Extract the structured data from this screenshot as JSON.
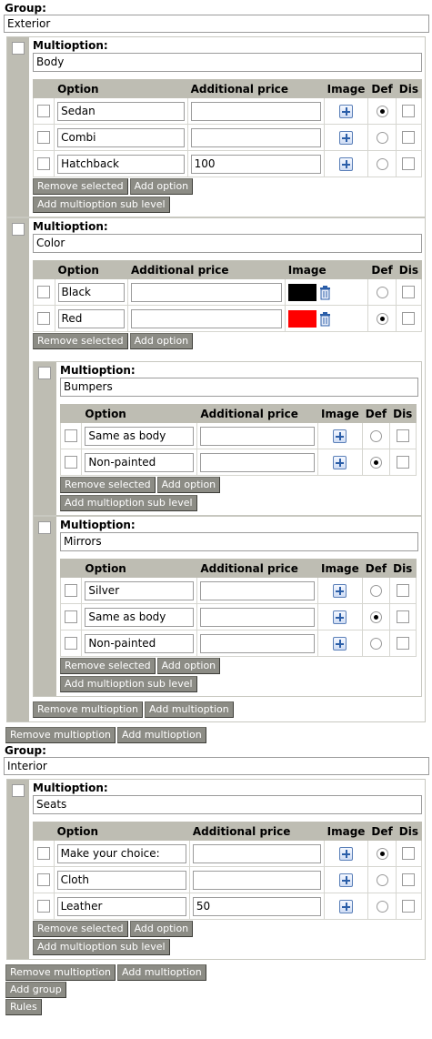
{
  "labels": {
    "group": "Group:",
    "multioption": "Multioption:",
    "option": "Option",
    "additional_price": "Additional price",
    "image": "Image",
    "def": "Def",
    "dis": "Dis"
  },
  "buttons": {
    "remove_selected": "Remove selected",
    "add_option": "Add option",
    "add_sub_level": "Add multioption sub level",
    "remove_multioption": "Remove multioption",
    "add_multioption": "Add multioption",
    "add_group": "Add group",
    "rules": "Rules"
  },
  "colors": {
    "black": "#000000",
    "red": "#ff0000",
    "panel": "#bebdb3",
    "button": "#8c8c85"
  },
  "groups": [
    {
      "name": "Exterior",
      "multioptions": [
        {
          "name": "Body",
          "options": [
            {
              "name": "Sedan",
              "price": "",
              "image": "plus-icon",
              "def": true
            },
            {
              "name": "Combi",
              "price": "",
              "image": "plus-icon",
              "def": false
            },
            {
              "name": "Hatchback",
              "price": "100",
              "image": "plus-icon",
              "def": false
            }
          ]
        },
        {
          "name": "Color",
          "options": [
            {
              "name": "Black",
              "price": "",
              "image": "color-swatch-black",
              "def": false
            },
            {
              "name": "Red",
              "price": "",
              "image": "color-swatch-red",
              "def": true
            }
          ],
          "sub_multioptions": [
            {
              "name": "Bumpers",
              "options": [
                {
                  "name": "Same as body",
                  "price": "",
                  "image": "plus-icon",
                  "def": false
                },
                {
                  "name": "Non-painted",
                  "price": "",
                  "image": "plus-icon",
                  "def": true
                }
              ]
            },
            {
              "name": "Mirrors",
              "options": [
                {
                  "name": "Silver",
                  "price": "",
                  "image": "plus-icon",
                  "def": false
                },
                {
                  "name": "Same as body",
                  "price": "",
                  "image": "plus-icon",
                  "def": true
                },
                {
                  "name": "Non-painted",
                  "price": "",
                  "image": "plus-icon",
                  "def": false
                }
              ]
            }
          ]
        }
      ]
    },
    {
      "name": "Interior",
      "multioptions": [
        {
          "name": "Seats",
          "options": [
            {
              "name": "Make your choice:",
              "price": "",
              "image": "plus-icon",
              "def": true
            },
            {
              "name": "Cloth",
              "price": "",
              "image": "plus-icon",
              "def": false
            },
            {
              "name": "Leather",
              "price": "50",
              "image": "plus-icon",
              "def": false
            }
          ]
        }
      ]
    }
  ]
}
